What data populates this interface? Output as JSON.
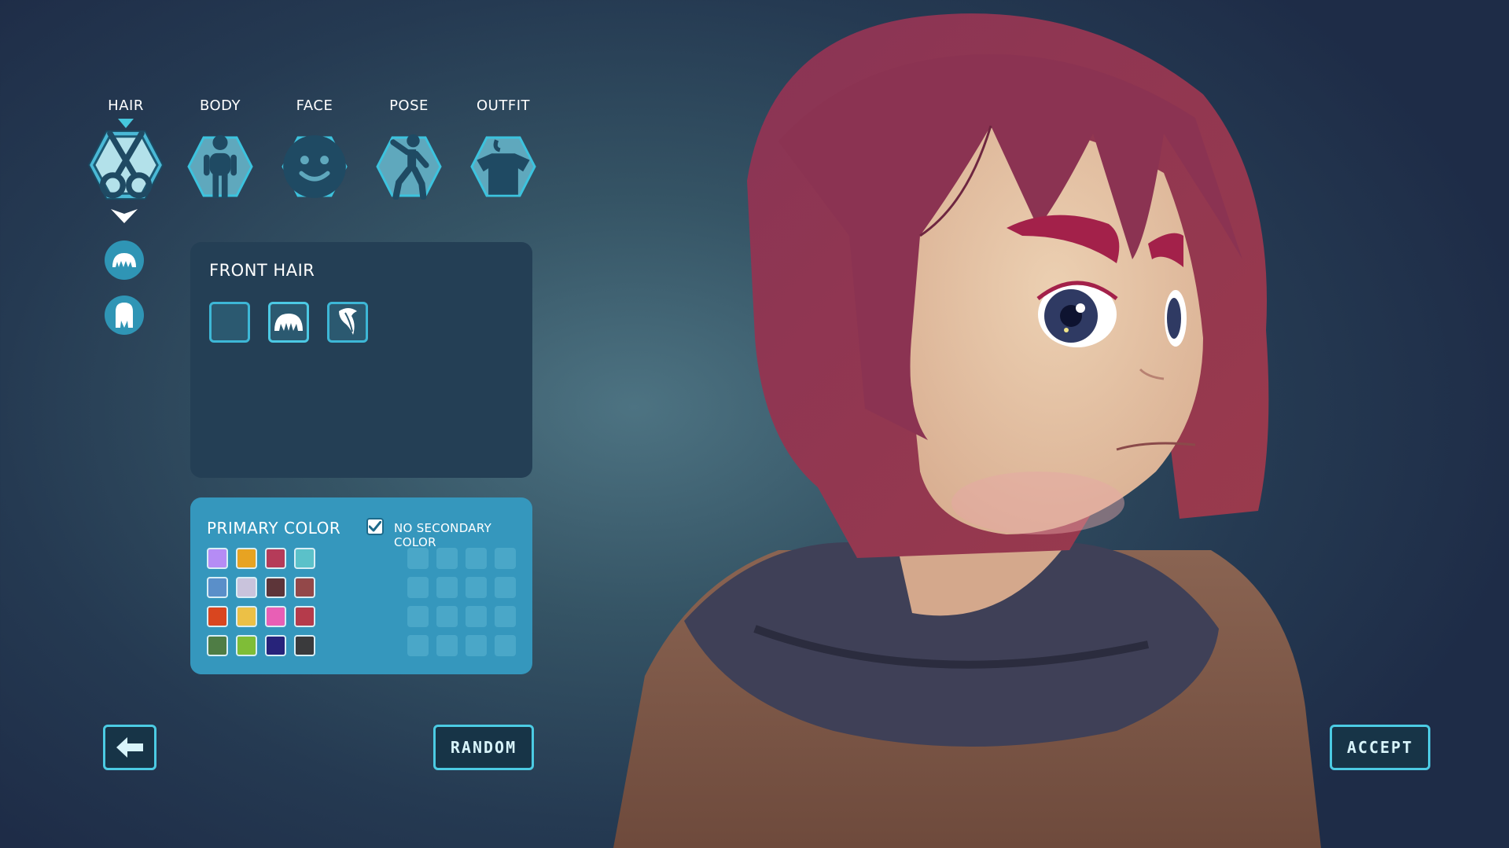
{
  "tabs": [
    {
      "label": "HAIR",
      "icon": "scissors-icon",
      "selected": true
    },
    {
      "label": "BODY",
      "icon": "person-icon",
      "selected": false
    },
    {
      "label": "FACE",
      "icon": "smiley-face-icon",
      "selected": false
    },
    {
      "label": "POSE",
      "icon": "pose-figure-icon",
      "selected": false
    },
    {
      "label": "OUTFIT",
      "icon": "shirt-icon",
      "selected": false
    }
  ],
  "sub_categories": [
    {
      "icon": "front-hair-icon",
      "selected": true
    },
    {
      "icon": "back-hair-icon",
      "selected": false
    }
  ],
  "front_hair": {
    "title": "FRONT HAIR",
    "options": [
      {
        "icon": "none-option",
        "selected": false
      },
      {
        "icon": "bangs-icon",
        "selected": true
      },
      {
        "icon": "side-swept-icon",
        "selected": false
      }
    ]
  },
  "color_panel": {
    "title": "PRIMARY COLOR",
    "no_secondary_label": "NO SECONDARY COLOR",
    "no_secondary_checked": true,
    "primary_colors": [
      [
        "#b58cf5",
        "#e7a322",
        "#b53b59",
        "#5bc1c9"
      ],
      [
        "#5a8fc9",
        "#c9c3dc",
        "#5d3539",
        "#934849"
      ],
      [
        "#d9461f",
        "#ecc046",
        "#e85fb5",
        "#b53b4b"
      ],
      [
        "#4f7d45",
        "#7fbd37",
        "#27237a",
        "#3a3a3c"
      ]
    ]
  },
  "buttons": {
    "back_icon": "arrow-left-icon",
    "random_label": "RANDOM",
    "accept_label": "ACCEPT"
  },
  "colors": {
    "accent": "#4ccbe3",
    "hex_fill": "#5fa8bd",
    "hex_selected_fill": "#a9dde8",
    "hair": "#8a3250",
    "skin": "#e6c3a2"
  }
}
